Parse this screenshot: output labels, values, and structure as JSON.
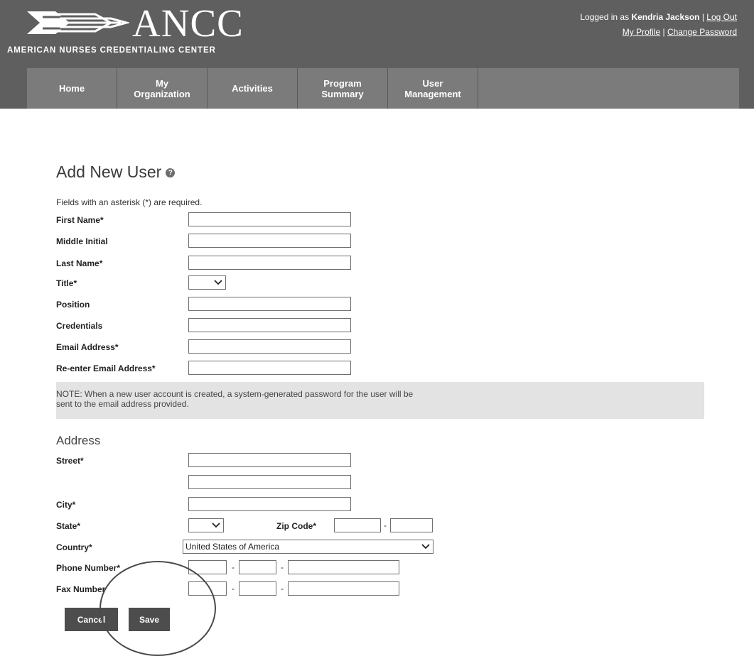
{
  "header": {
    "logo_title": "ANCC",
    "logo_subtitle": "AMERICAN NURSES CREDENTIALING CENTER",
    "logged_in_prefix": "Logged in as",
    "user_name": "Kendria Jackson",
    "logout": "Log Out",
    "my_profile": "My Profile",
    "change_password": "Change Password",
    "separator": "|"
  },
  "nav": {
    "items": [
      {
        "label": "Home"
      },
      {
        "label": "My\nOrganization"
      },
      {
        "label": "Activities"
      },
      {
        "label": "Program\nSummary"
      },
      {
        "label": "User\nManagement"
      }
    ]
  },
  "page": {
    "title": "Add New User",
    "help_icon": "?",
    "required_note": "Fields with an asterisk (*) are required."
  },
  "form": {
    "first_name": {
      "label": "First Name*",
      "value": ""
    },
    "middle_initial": {
      "label": "Middle Initial",
      "value": ""
    },
    "last_name": {
      "label": "Last Name*",
      "value": ""
    },
    "title": {
      "label": "Title*",
      "selected": ""
    },
    "position": {
      "label": "Position",
      "value": ""
    },
    "credentials": {
      "label": "Credentials",
      "value": ""
    },
    "email": {
      "label": "Email Address*",
      "value": ""
    },
    "email_confirm": {
      "label": "Re-enter Email Address*",
      "value": ""
    }
  },
  "note": "NOTE: When a new user account is created, a system-generated password for the user will be sent to the email address provided.",
  "address": {
    "section_title": "Address",
    "street": {
      "label": "Street*",
      "value1": "",
      "value2": ""
    },
    "city": {
      "label": "City*",
      "value": ""
    },
    "state": {
      "label": "State*",
      "selected": ""
    },
    "zip": {
      "label": "Zip Code*",
      "value1": "",
      "value2": ""
    },
    "country": {
      "label": "Country*",
      "selected": "United States of America"
    },
    "phone": {
      "label": "Phone Number*"
    },
    "fax": {
      "label": "Fax Number"
    }
  },
  "buttons": {
    "cancel": "Cancel",
    "save": "Save"
  },
  "dash": "-",
  "colors": {
    "header_bg": "#5f5f5f",
    "nav_bg": "#7b7b7b",
    "button_bg": "#4d4d4d",
    "note_bg": "#e3e3e3"
  }
}
